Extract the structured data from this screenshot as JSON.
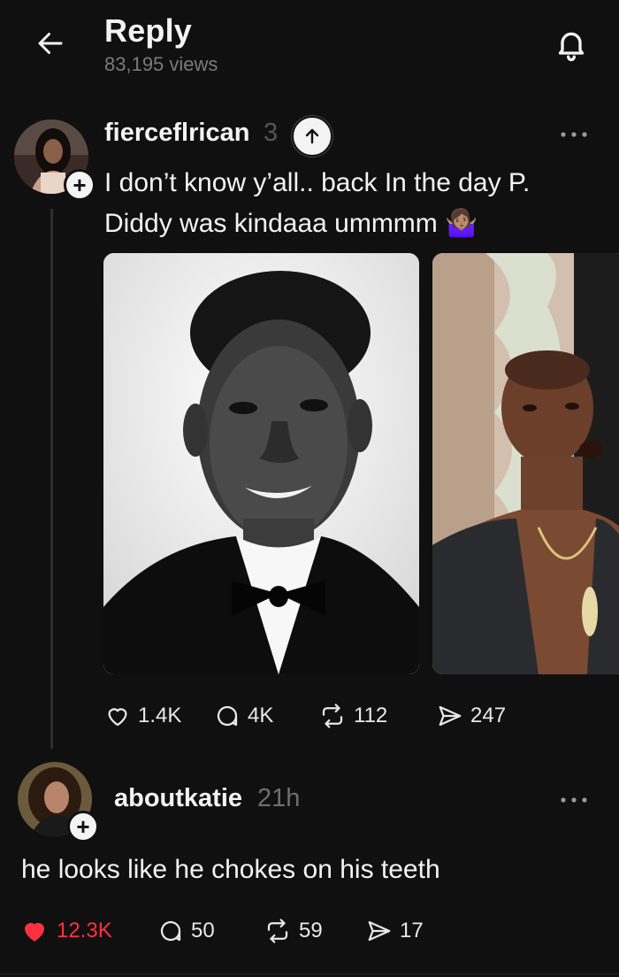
{
  "header": {
    "title": "Reply",
    "views": "83,195 views"
  },
  "post": {
    "username": "fierceflrican",
    "time": "3",
    "text": "I don’t know y’all.. back In the day P. Diddy was kindaaa ummmm 🤷🏽‍♀️",
    "likes": "1.4K",
    "replies": "4K",
    "reposts": "112",
    "shares": "247"
  },
  "reply": {
    "username": "aboutkatie",
    "time": "21h",
    "text": "he looks like he chokes on his teeth",
    "likes": "12.3K",
    "replies": "50",
    "reposts": "59",
    "shares": "17"
  },
  "colors": {
    "background": "#101010",
    "like_active": "#ff3040"
  }
}
